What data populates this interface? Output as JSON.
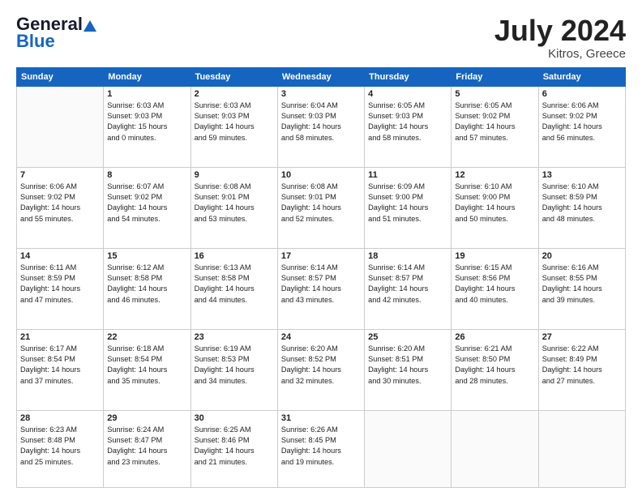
{
  "header": {
    "logo_line1": "General",
    "logo_line2": "Blue",
    "month": "July 2024",
    "location": "Kitros, Greece"
  },
  "days_of_week": [
    "Sunday",
    "Monday",
    "Tuesday",
    "Wednesday",
    "Thursday",
    "Friday",
    "Saturday"
  ],
  "weeks": [
    [
      {
        "day": "",
        "info": ""
      },
      {
        "day": "1",
        "info": "Sunrise: 6:03 AM\nSunset: 9:03 PM\nDaylight: 15 hours\nand 0 minutes."
      },
      {
        "day": "2",
        "info": "Sunrise: 6:03 AM\nSunset: 9:03 PM\nDaylight: 14 hours\nand 59 minutes."
      },
      {
        "day": "3",
        "info": "Sunrise: 6:04 AM\nSunset: 9:03 PM\nDaylight: 14 hours\nand 58 minutes."
      },
      {
        "day": "4",
        "info": "Sunrise: 6:05 AM\nSunset: 9:03 PM\nDaylight: 14 hours\nand 58 minutes."
      },
      {
        "day": "5",
        "info": "Sunrise: 6:05 AM\nSunset: 9:02 PM\nDaylight: 14 hours\nand 57 minutes."
      },
      {
        "day": "6",
        "info": "Sunrise: 6:06 AM\nSunset: 9:02 PM\nDaylight: 14 hours\nand 56 minutes."
      }
    ],
    [
      {
        "day": "7",
        "info": "Sunrise: 6:06 AM\nSunset: 9:02 PM\nDaylight: 14 hours\nand 55 minutes."
      },
      {
        "day": "8",
        "info": "Sunrise: 6:07 AM\nSunset: 9:02 PM\nDaylight: 14 hours\nand 54 minutes."
      },
      {
        "day": "9",
        "info": "Sunrise: 6:08 AM\nSunset: 9:01 PM\nDaylight: 14 hours\nand 53 minutes."
      },
      {
        "day": "10",
        "info": "Sunrise: 6:08 AM\nSunset: 9:01 PM\nDaylight: 14 hours\nand 52 minutes."
      },
      {
        "day": "11",
        "info": "Sunrise: 6:09 AM\nSunset: 9:00 PM\nDaylight: 14 hours\nand 51 minutes."
      },
      {
        "day": "12",
        "info": "Sunrise: 6:10 AM\nSunset: 9:00 PM\nDaylight: 14 hours\nand 50 minutes."
      },
      {
        "day": "13",
        "info": "Sunrise: 6:10 AM\nSunset: 8:59 PM\nDaylight: 14 hours\nand 48 minutes."
      }
    ],
    [
      {
        "day": "14",
        "info": "Sunrise: 6:11 AM\nSunset: 8:59 PM\nDaylight: 14 hours\nand 47 minutes."
      },
      {
        "day": "15",
        "info": "Sunrise: 6:12 AM\nSunset: 8:58 PM\nDaylight: 14 hours\nand 46 minutes."
      },
      {
        "day": "16",
        "info": "Sunrise: 6:13 AM\nSunset: 8:58 PM\nDaylight: 14 hours\nand 44 minutes."
      },
      {
        "day": "17",
        "info": "Sunrise: 6:14 AM\nSunset: 8:57 PM\nDaylight: 14 hours\nand 43 minutes."
      },
      {
        "day": "18",
        "info": "Sunrise: 6:14 AM\nSunset: 8:57 PM\nDaylight: 14 hours\nand 42 minutes."
      },
      {
        "day": "19",
        "info": "Sunrise: 6:15 AM\nSunset: 8:56 PM\nDaylight: 14 hours\nand 40 minutes."
      },
      {
        "day": "20",
        "info": "Sunrise: 6:16 AM\nSunset: 8:55 PM\nDaylight: 14 hours\nand 39 minutes."
      }
    ],
    [
      {
        "day": "21",
        "info": "Sunrise: 6:17 AM\nSunset: 8:54 PM\nDaylight: 14 hours\nand 37 minutes."
      },
      {
        "day": "22",
        "info": "Sunrise: 6:18 AM\nSunset: 8:54 PM\nDaylight: 14 hours\nand 35 minutes."
      },
      {
        "day": "23",
        "info": "Sunrise: 6:19 AM\nSunset: 8:53 PM\nDaylight: 14 hours\nand 34 minutes."
      },
      {
        "day": "24",
        "info": "Sunrise: 6:20 AM\nSunset: 8:52 PM\nDaylight: 14 hours\nand 32 minutes."
      },
      {
        "day": "25",
        "info": "Sunrise: 6:20 AM\nSunset: 8:51 PM\nDaylight: 14 hours\nand 30 minutes."
      },
      {
        "day": "26",
        "info": "Sunrise: 6:21 AM\nSunset: 8:50 PM\nDaylight: 14 hours\nand 28 minutes."
      },
      {
        "day": "27",
        "info": "Sunrise: 6:22 AM\nSunset: 8:49 PM\nDaylight: 14 hours\nand 27 minutes."
      }
    ],
    [
      {
        "day": "28",
        "info": "Sunrise: 6:23 AM\nSunset: 8:48 PM\nDaylight: 14 hours\nand 25 minutes."
      },
      {
        "day": "29",
        "info": "Sunrise: 6:24 AM\nSunset: 8:47 PM\nDaylight: 14 hours\nand 23 minutes."
      },
      {
        "day": "30",
        "info": "Sunrise: 6:25 AM\nSunset: 8:46 PM\nDaylight: 14 hours\nand 21 minutes."
      },
      {
        "day": "31",
        "info": "Sunrise: 6:26 AM\nSunset: 8:45 PM\nDaylight: 14 hours\nand 19 minutes."
      },
      {
        "day": "",
        "info": ""
      },
      {
        "day": "",
        "info": ""
      },
      {
        "day": "",
        "info": ""
      }
    ]
  ]
}
